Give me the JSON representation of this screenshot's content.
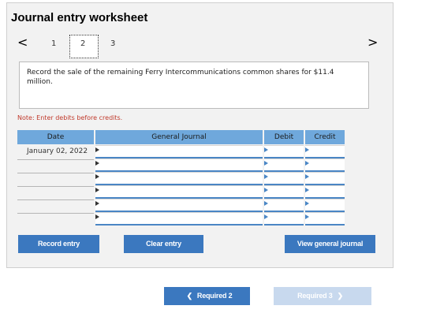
{
  "title": "Journal entry worksheet",
  "pagination": {
    "prev": "<",
    "next": ">",
    "pages": [
      "1",
      "2",
      "3"
    ],
    "current": "2"
  },
  "instruction": "Record the sale of the remaining Ferry Intercommunications common shares for $11.4 million.",
  "note": "Note: Enter debits before credits.",
  "table": {
    "headers": {
      "date": "Date",
      "general_journal": "General Journal",
      "debit": "Debit",
      "credit": "Credit"
    },
    "rows": [
      {
        "date": "January 02, 2022",
        "account": "",
        "debit": "",
        "credit": ""
      },
      {
        "date": "",
        "account": "",
        "debit": "",
        "credit": ""
      },
      {
        "date": "",
        "account": "",
        "debit": "",
        "credit": ""
      },
      {
        "date": "",
        "account": "",
        "debit": "",
        "credit": ""
      },
      {
        "date": "",
        "account": "",
        "debit": "",
        "credit": ""
      },
      {
        "date": "",
        "account": "",
        "debit": "",
        "credit": ""
      }
    ]
  },
  "buttons": {
    "record": "Record entry",
    "clear": "Clear entry",
    "view": "View general journal",
    "required_prev": "Required 2",
    "required_next": "Required 3"
  },
  "colors": {
    "header_blue": "#6fa8dc",
    "button_blue": "#3b78bf",
    "button_disabled": "#c8d9ee",
    "note_red": "#c0392b"
  },
  "icons": {
    "prev": "chevron-left-icon",
    "next": "chevron-right-icon"
  }
}
